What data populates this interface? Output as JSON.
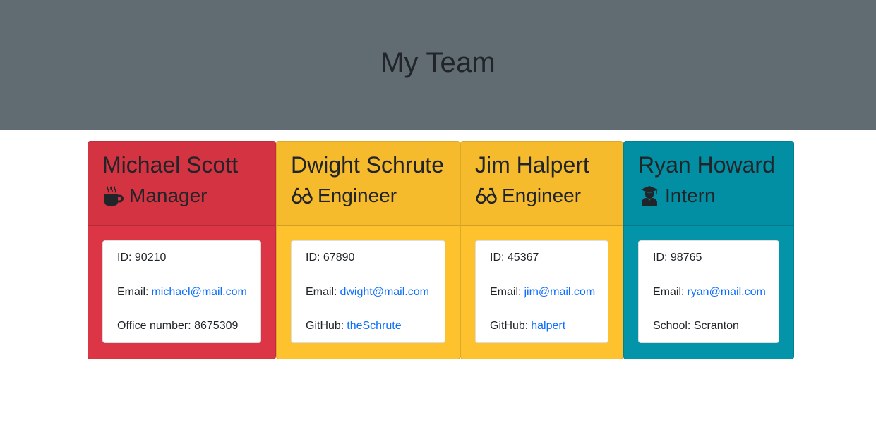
{
  "header": {
    "title": "My Team"
  },
  "colors": {
    "jumbotron": "#616b72",
    "manager": "#dc3545",
    "engineer": "#ffc22f",
    "intern": "#0394a9",
    "link": "#0d6efd"
  },
  "employees": [
    {
      "name": "Michael Scott",
      "role": "Manager",
      "icon": "mug-icon",
      "id_label": "ID:",
      "id": "90210",
      "email_label": "Email:",
      "email": "michael@mail.com",
      "extra_label": "Office number:",
      "extra": "8675309"
    },
    {
      "name": "Dwight Schrute",
      "role": "Engineer",
      "icon": "glasses-icon",
      "id_label": "ID:",
      "id": "67890",
      "email_label": "Email:",
      "email": "dwight@mail.com",
      "extra_label": "GitHub:",
      "extra": "theSchrute"
    },
    {
      "name": "Jim Halpert",
      "role": "Engineer",
      "icon": "glasses-icon",
      "id_label": "ID:",
      "id": "45367",
      "email_label": "Email:",
      "email": "jim@mail.com",
      "extra_label": "GitHub:",
      "extra": "halpert"
    },
    {
      "name": "Ryan Howard",
      "role": "Intern",
      "icon": "graduate-icon",
      "id_label": "ID:",
      "id": "98765",
      "email_label": "Email:",
      "email": "ryan@mail.com",
      "extra_label": "School:",
      "extra": "Scranton"
    }
  ]
}
